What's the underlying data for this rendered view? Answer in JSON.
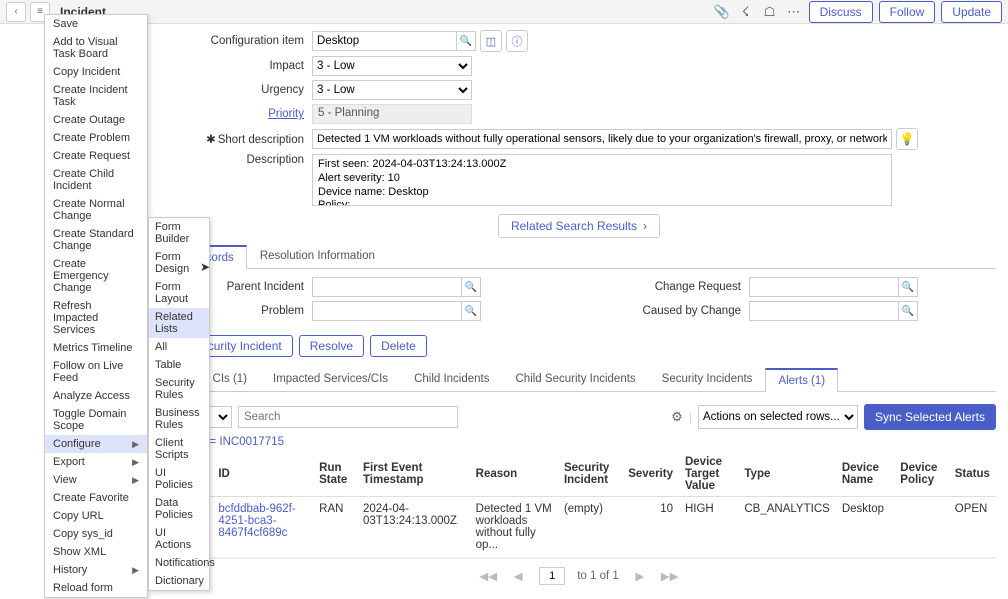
{
  "topbar": {
    "title": "Incident",
    "buttons": {
      "discuss": "Discuss",
      "follow": "Follow",
      "update": "Update"
    }
  },
  "context_menu": {
    "items": [
      "Save",
      "Add to Visual Task Board",
      "Copy Incident",
      "Create Incident Task",
      "Create Outage",
      "Create Problem",
      "Create Request",
      "Create Child Incident",
      "Create Normal Change",
      "Create Standard Change",
      "Create Emergency Change",
      "Refresh Impacted Services",
      "Metrics Timeline",
      "Follow on Live Feed",
      "Analyze Access",
      "Toggle Domain Scope"
    ],
    "submenus": [
      {
        "label": "Configure",
        "has_arrow": true,
        "highlighted": true
      },
      {
        "label": "Export",
        "has_arrow": true
      },
      {
        "label": "View",
        "has_arrow": true
      }
    ],
    "tail": [
      "Create Favorite",
      "Copy URL",
      "Copy sys_id",
      "Show XML"
    ],
    "tail_sub": [
      {
        "label": "History",
        "has_arrow": true
      }
    ],
    "tail2": [
      "Reload form"
    ]
  },
  "configure_submenu": [
    "Form Builder",
    "Form Design",
    "Form Layout",
    "Related Lists",
    "All",
    "Table",
    "Security Rules",
    "Business Rules",
    "Client Scripts",
    "UI Policies",
    "Data Policies",
    "UI Actions",
    "Notifications",
    "Dictionary"
  ],
  "form": {
    "config_item_label": "Configuration item",
    "config_item_value": "Desktop",
    "impact_label": "Impact",
    "impact_value": "3 - Low",
    "urgency_label": "Urgency",
    "urgency_value": "3 - Low",
    "priority_label": "Priority",
    "priority_value": "5 - Planning",
    "short_desc_label": "Short description",
    "short_desc_value": "Detected 1 VM workloads without fully operational sensors, likely due to your organization's firewall, proxy, or network settings.View the assets [https://defe",
    "description_label": "Description",
    "description_value": "First seen: 2024-04-03T13:24:13.000Z\nAlert severity: 10\nDevice name: Desktop\nPolicy:",
    "related_search": "Related Search Results"
  },
  "mid_tabs": {
    "t1_suffix": "ed Records",
    "t2": "Resolution Information"
  },
  "refs": {
    "parent_incident": "Parent Incident",
    "problem": "Problem",
    "change_request": "Change Request",
    "caused_by_change": "Caused by Change"
  },
  "action_buttons": {
    "create_sec": "ate Security Incident",
    "resolve": "Resolve",
    "delete": "Delete"
  },
  "lower_tabs": {
    "t1": "ffected CIs (1)",
    "t2": "Impacted Services/CIs",
    "t3": "Child Incidents",
    "t4": "Child Security Incidents",
    "t5": "Security Incidents",
    "t6": "Alerts (1)"
  },
  "list": {
    "search_placeholder": "Search",
    "actions_placeholder": "Actions on selected rows...",
    "sync_label": "Sync Selected Alerts",
    "breadcrumb": "Incident = INC0017715",
    "headers": {
      "id": "ID",
      "run_state": "Run State",
      "first_event": "First Event Timestamp",
      "reason": "Reason",
      "sec_inc": "Security Incident",
      "severity": "Severity",
      "target": "Device Target Value",
      "type": "Type",
      "device": "Device Name",
      "policy": "Device Policy",
      "status": "Status"
    },
    "row": {
      "id": "bcfddbab-962f-4251-bca3-8467f4cf689c",
      "run_state": "RAN",
      "first_event": "2024-04-03T13:24:13.000Z",
      "reason": "Detected 1 VM workloads without fully op...",
      "sec_inc": "(empty)",
      "severity": "10",
      "target": "HIGH",
      "type": "CB_ANALYTICS",
      "device": "Desktop",
      "policy": "",
      "status": "OPEN"
    },
    "pager": {
      "page": "1",
      "range": "to 1 of 1"
    }
  }
}
